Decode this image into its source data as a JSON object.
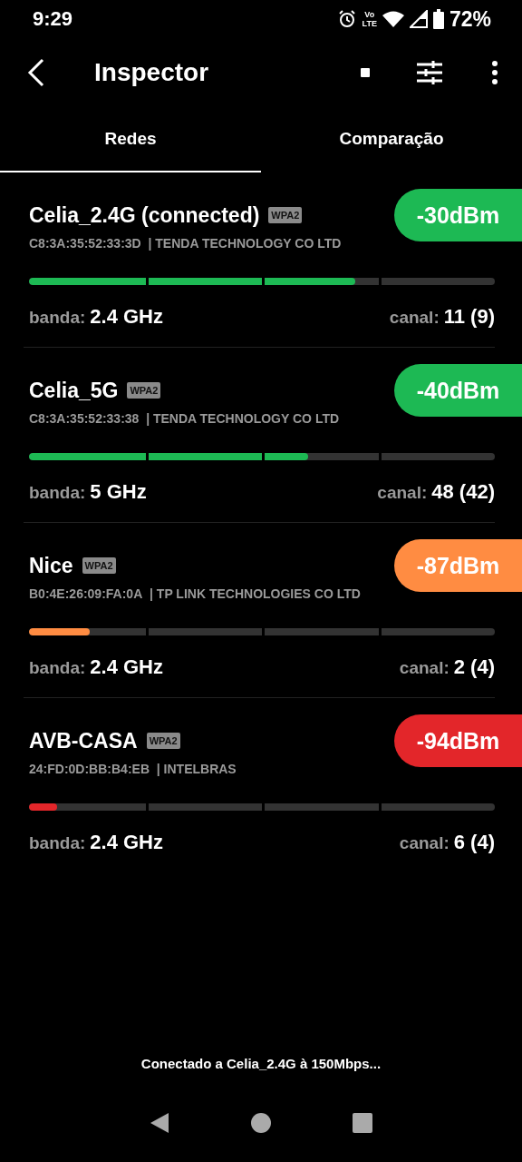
{
  "status_bar": {
    "time": "9:29",
    "network_top": "Vo",
    "network_bottom": "LTE",
    "battery": "72%"
  },
  "app_bar": {
    "title": "Inspector"
  },
  "tabs": [
    {
      "label": "Redes",
      "selected": true
    },
    {
      "label": "Comparação",
      "selected": false
    }
  ],
  "networks": [
    {
      "name": "Celia_2.4G (connected)",
      "security": "WPA2",
      "mac": "C8:3A:35:52:33:3D",
      "vendor": "| TENDA TECHNOLOGY CO LTD",
      "signal": "-30dBm",
      "color": "#1db954",
      "level": 0.7,
      "band_label": "banda:",
      "band": "2.4 GHz",
      "channel_label": "canal:",
      "channel": "11 (9)"
    },
    {
      "name": "Celia_5G",
      "security": "WPA2",
      "mac": "C8:3A:35:52:33:38",
      "vendor": "| TENDA TECHNOLOGY CO LTD",
      "signal": "-40dBm",
      "color": "#1db954",
      "level": 0.6,
      "band_label": "banda:",
      "band": "5 GHz",
      "channel_label": "canal:",
      "channel": "48 (42)"
    },
    {
      "name": "Nice",
      "security": "WPA2",
      "mac": "B0:4E:26:09:FA:0A",
      "vendor": "| TP LINK TECHNOLOGIES CO LTD",
      "signal": "-87dBm",
      "color": "#ff8c42",
      "level": 0.13,
      "band_label": "banda:",
      "band": "2.4 GHz",
      "channel_label": "canal:",
      "channel": "2 (4)"
    },
    {
      "name": "AVB-CASA",
      "security": "WPA2",
      "mac": "24:FD:0D:BB:B4:EB",
      "vendor": "| INTELBRAS",
      "signal": "-94dBm",
      "color": "#e3262a",
      "level": 0.06,
      "band_label": "banda:",
      "band": "2.4 GHz",
      "channel_label": "canal:",
      "channel": "6 (4)"
    }
  ],
  "footer": {
    "message": "Conectado a Celia_2.4G à 150Mbps..."
  }
}
